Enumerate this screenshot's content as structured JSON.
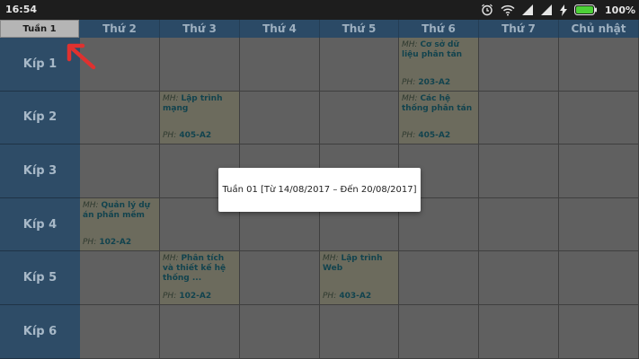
{
  "status_bar": {
    "time": "16:54",
    "battery_percent": "100%"
  },
  "header": {
    "week_button": "Tuần 1",
    "days": [
      "Thứ 2",
      "Thứ 3",
      "Thứ 4",
      "Thứ 5",
      "Thứ 6",
      "Thứ 7",
      "Chủ nhật"
    ]
  },
  "periods": [
    "Kíp 1",
    "Kíp 2",
    "Kíp 3",
    "Kíp 4",
    "Kíp 5",
    "Kíp 6"
  ],
  "labels": {
    "mh": "MH:",
    "ph": "PH:"
  },
  "courses": [
    {
      "day": 4,
      "period": 0,
      "subject": "Cơ sở dữ liệu phân tán",
      "room": "203-A2"
    },
    {
      "day": 1,
      "period": 1,
      "subject": "Lập trình mạng",
      "room": "405-A2"
    },
    {
      "day": 4,
      "period": 1,
      "subject": "Các hệ thống phân tán",
      "room": "405-A2"
    },
    {
      "day": 0,
      "period": 3,
      "subject": "Quản lý dự án phần mềm",
      "room": "102-A2"
    },
    {
      "day": 1,
      "period": 4,
      "subject": "Phân tích và thiết kế hệ thống ...",
      "room": "102-A2"
    },
    {
      "day": 3,
      "period": 4,
      "subject": "Lập trình Web",
      "room": "403-A2"
    }
  ],
  "dialog": {
    "text": "Tuần 01 [Từ 14/08/2017 – Đến 20/08/2017]"
  },
  "colors": {
    "header_bg": "#2b4a66",
    "period_bg": "#2e4c67",
    "course_bg": "#6c6b5d",
    "arrow": "#e0312f"
  }
}
